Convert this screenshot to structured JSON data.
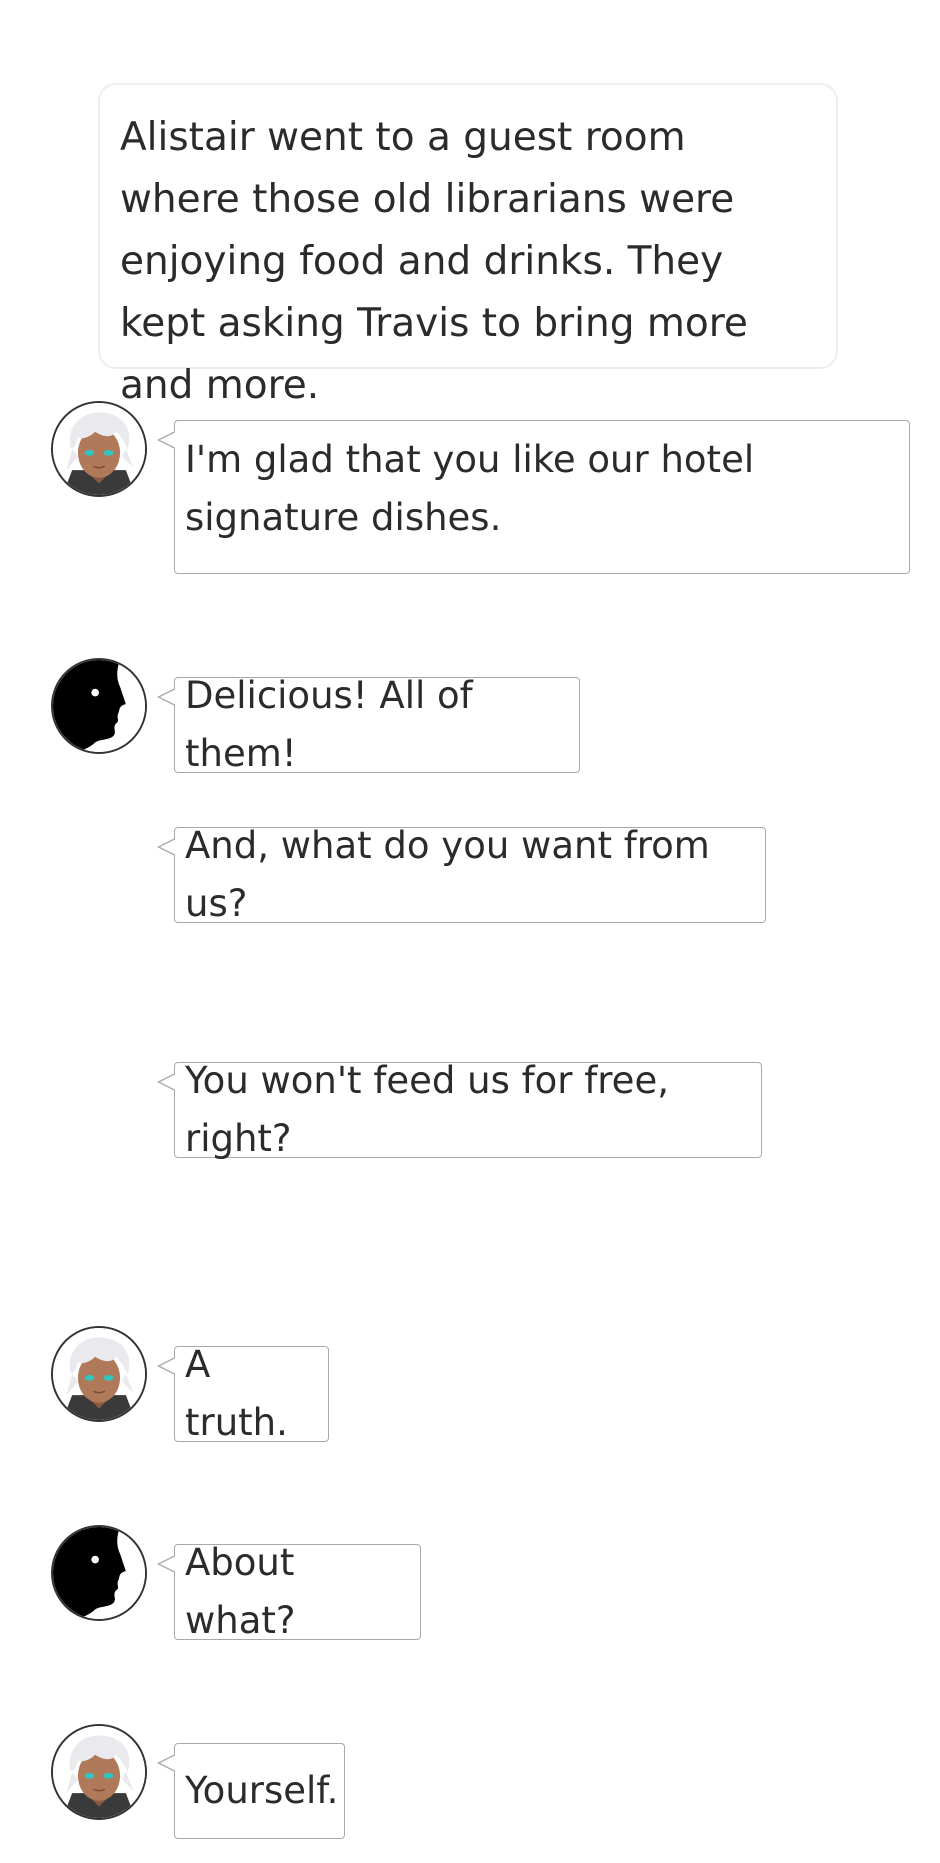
{
  "narration": {
    "text": "Alistair went to a guest room where those old librarians were enjoying food and drinks. They kept asking Travis to bring more and more."
  },
  "characters": {
    "alistair": {
      "icon": "alistair-avatar-icon",
      "hair": "#e9e9ee",
      "skin": "#b07a5a",
      "eyes": "#2ec5c2"
    },
    "silhouette": {
      "icon": "silhouette-avatar-icon",
      "fill": "#000000"
    }
  },
  "messages": [
    {
      "speaker": "alistair",
      "text": "I'm glad that you like our hotel signature dishes."
    },
    {
      "speaker": "silhouette",
      "text": "Delicious! All of them!"
    },
    {
      "speaker": "silhouette",
      "text": "And, what do you want from us?"
    },
    {
      "speaker": "silhouette",
      "text": "You won't feed us for free, right?"
    },
    {
      "speaker": "alistair",
      "text": "A truth."
    },
    {
      "speaker": "silhouette",
      "text": "About what?"
    },
    {
      "speaker": "alistair",
      "text": "Yourself."
    }
  ]
}
